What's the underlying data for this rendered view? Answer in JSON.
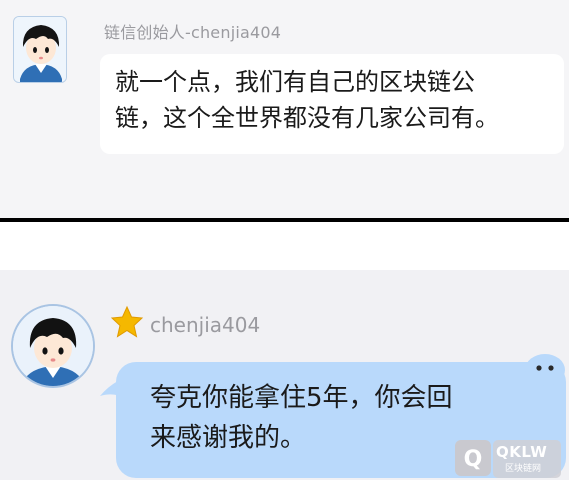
{
  "messages": [
    {
      "sender": "链信创始人-chenjia404",
      "text_line1": "就一个点，我们有自己的区块链公",
      "text_line2": "链，这个全世界都没有几家公司有。"
    },
    {
      "sender": "chenjia404",
      "text_line1": "夸克你能拿住5年，你会回",
      "text_line2": "来感谢我的。"
    }
  ],
  "watermark": {
    "text": "QKLW",
    "subtext": "区块链网"
  },
  "colors": {
    "bubble_self": "#b9d9fb",
    "bubble_other": "#ffffff",
    "sender_text": "#9a9a9f",
    "star": "#f5b800"
  },
  "icons": [
    "avatar-cartoon-icon",
    "star-icon",
    "bubble-tail-icon"
  ]
}
